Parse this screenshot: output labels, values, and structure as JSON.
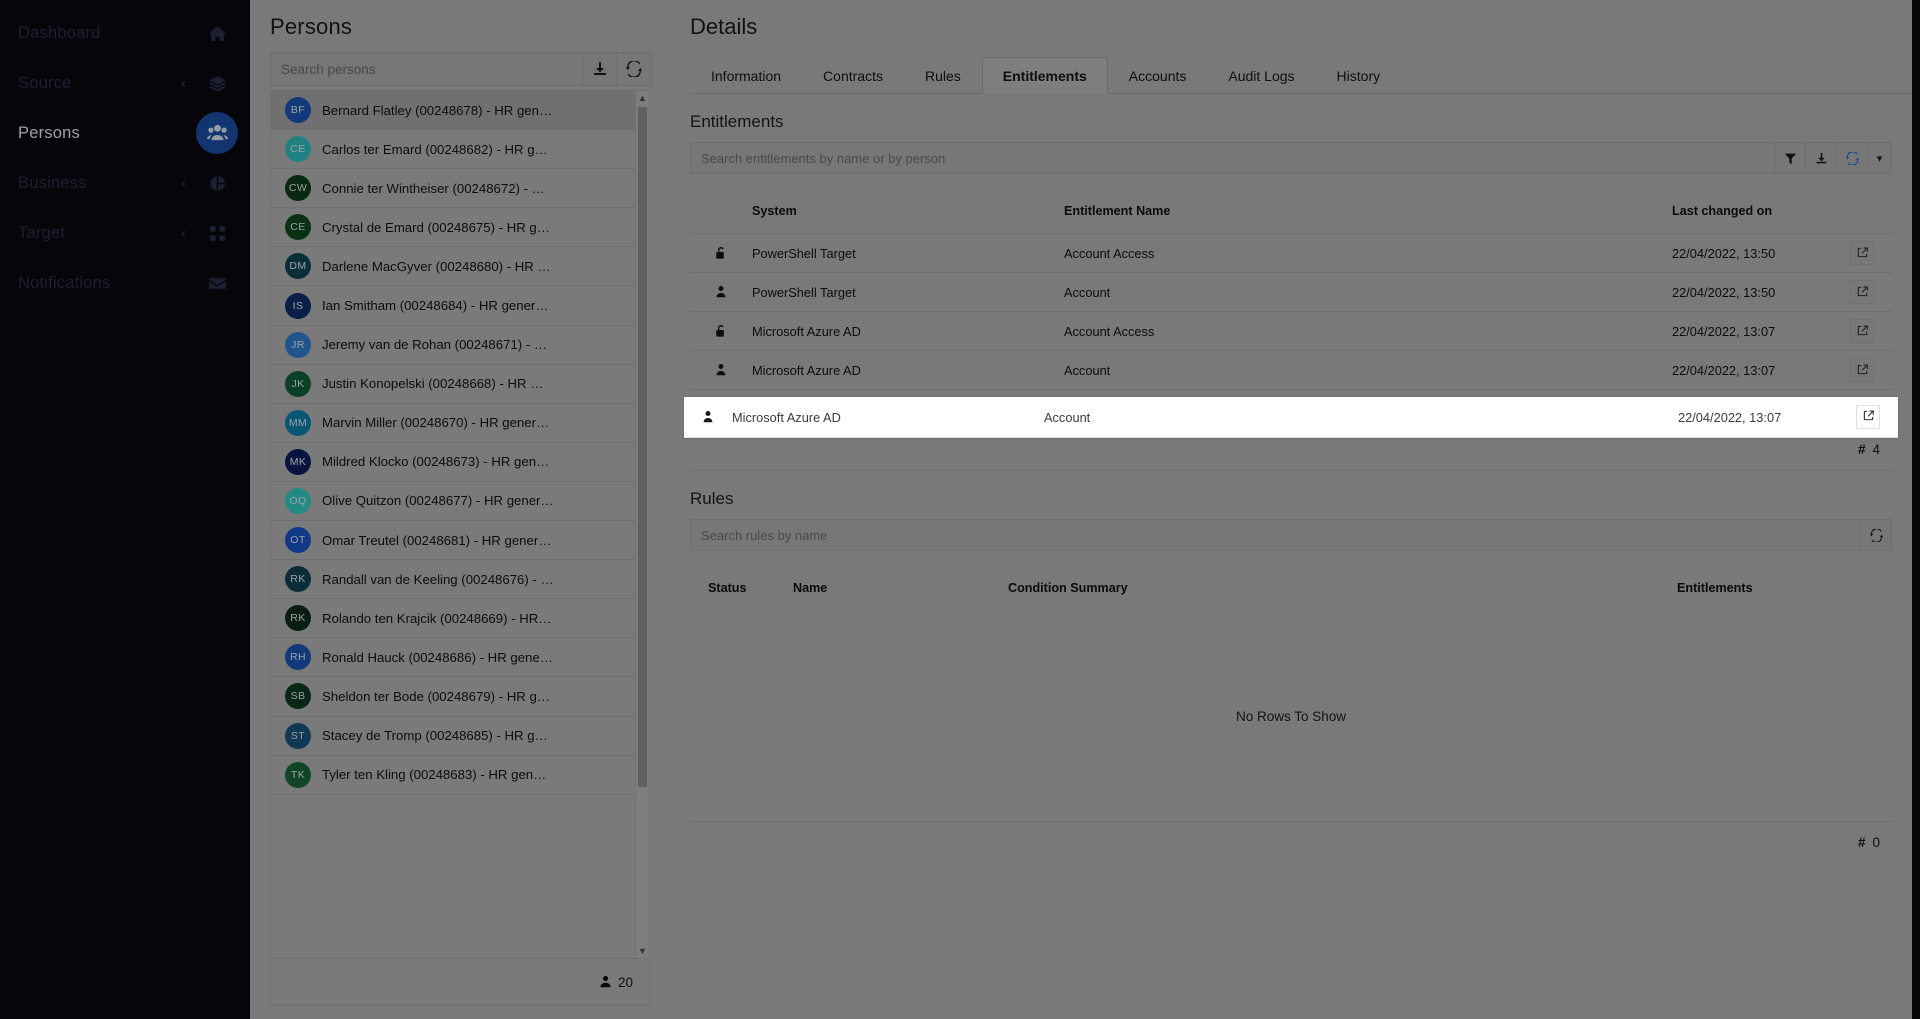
{
  "sidebar": {
    "items": [
      {
        "label": "Dashboard",
        "icon": "home-icon",
        "expandable": false,
        "active": false
      },
      {
        "label": "Source",
        "icon": "layers-icon",
        "expandable": true,
        "active": false
      },
      {
        "label": "Persons",
        "icon": "people-icon",
        "expandable": false,
        "active": true
      },
      {
        "label": "Business",
        "icon": "pie-chart-icon",
        "expandable": true,
        "active": false
      },
      {
        "label": "Target",
        "icon": "grid-icon",
        "expandable": true,
        "active": false
      },
      {
        "label": "Notifications",
        "icon": "envelope-icon",
        "expandable": false,
        "active": false
      }
    ],
    "chevron": "‹",
    "accent_color": "#1b4fa8"
  },
  "persons_panel": {
    "title": "Persons",
    "search_placeholder": "Search persons",
    "download_tooltip": "Download",
    "refresh_tooltip": "Refresh",
    "footer_count": "20",
    "items": [
      {
        "initials": "BF",
        "name": "Bernard Flatley (00248678) - HR gen…",
        "color": "#1b56b5",
        "selected": true
      },
      {
        "initials": "CE",
        "name": "Carlos ter Emard (00248682) - HR g…",
        "color": "#2fc1c0",
        "selected": false
      },
      {
        "initials": "CW",
        "name": "Connie ter Wintheiser (00248672) - …",
        "color": "#0c3d17",
        "selected": false
      },
      {
        "initials": "CE",
        "name": "Crystal de Emard (00248675) - HR g…",
        "color": "#0e4a1e",
        "selected": false
      },
      {
        "initials": "DM",
        "name": "Darlene MacGyver (00248680) - HR …",
        "color": "#0f4554",
        "selected": false
      },
      {
        "initials": "IS",
        "name": "Ian Smitham (00248684) - HR gener…",
        "color": "#0e2f6b",
        "selected": false
      },
      {
        "initials": "JR",
        "name": "Jeremy van de Rohan (00248671) - …",
        "color": "#2f7fd1",
        "selected": false
      },
      {
        "initials": "JK",
        "name": "Justin Konopelski (00248668) - HR …",
        "color": "#11603a",
        "selected": false
      },
      {
        "initials": "MM",
        "name": "Marvin Miller (00248670) - HR gener…",
        "color": "#0e7fae",
        "selected": false
      },
      {
        "initials": "MK",
        "name": "Mildred Klocko (00248673) - HR gen…",
        "color": "#0c1f5e",
        "selected": false
      },
      {
        "initials": "OQ",
        "name": "Olive Quitzon (00248677) - HR gener…",
        "color": "#33ccc4",
        "selected": false
      },
      {
        "initials": "OT",
        "name": "Omar Treutel (00248681) - HR gener…",
        "color": "#1b56c9",
        "selected": false
      },
      {
        "initials": "RK",
        "name": "Randall van de Keeling (00248676) - …",
        "color": "#0f4352",
        "selected": false
      },
      {
        "initials": "RK",
        "name": "Rolando ten Krajcik (00248669) - HR…",
        "color": "#0b2e18",
        "selected": false
      },
      {
        "initials": "RH",
        "name": "Ronald Hauck (00248686) - HR gene…",
        "color": "#1b56b5",
        "selected": false
      },
      {
        "initials": "SB",
        "name": "Sheldon ter Bode (00248679) - HR g…",
        "color": "#0d3b22",
        "selected": false
      },
      {
        "initials": "ST",
        "name": "Stacey de Tromp (00248685) - HR g…",
        "color": "#17567f",
        "selected": false
      },
      {
        "initials": "TK",
        "name": "Tyler ten Kling (00248683) - HR gen…",
        "color": "#18683a",
        "selected": false
      }
    ]
  },
  "details_panel": {
    "title": "Details",
    "tabs": [
      {
        "label": "Information",
        "active": false
      },
      {
        "label": "Contracts",
        "active": false
      },
      {
        "label": "Rules",
        "active": false
      },
      {
        "label": "Entitlements",
        "active": true
      },
      {
        "label": "Accounts",
        "active": false
      },
      {
        "label": "Audit Logs",
        "active": false
      },
      {
        "label": "History",
        "active": false
      }
    ]
  },
  "entitlements": {
    "title": "Entitlements",
    "search_placeholder": "Search entitlements by name or by person",
    "toolbar": {
      "filter": "filter-icon",
      "download": "download-icon",
      "refresh": "refresh-icon",
      "expand": "chevron-down-icon",
      "refresh_color": "#1565d8"
    },
    "columns": [
      "",
      "System",
      "Entitlement Name",
      "Last changed on",
      ""
    ],
    "rows": [
      {
        "icon": "unlock-icon",
        "system": "PowerShell Target",
        "name": "Account Access",
        "changed": "22/04/2022, 13:50",
        "action": "open-external-icon",
        "highlighted": false
      },
      {
        "icon": "person-icon",
        "system": "PowerShell Target",
        "name": "Account",
        "changed": "22/04/2022, 13:50",
        "action": "open-external-icon",
        "highlighted": false
      },
      {
        "icon": "unlock-icon",
        "system": "Microsoft Azure AD",
        "name": "Account Access",
        "changed": "22/04/2022, 13:07",
        "action": "open-external-icon",
        "highlighted": false
      },
      {
        "icon": "person-icon",
        "system": "Microsoft Azure AD",
        "name": "Account",
        "changed": "22/04/2022, 13:07",
        "action": "open-external-icon",
        "highlighted": true
      }
    ],
    "count_symbol": "#",
    "count": "4"
  },
  "rules": {
    "title": "Rules",
    "search_placeholder": "Search rules by name",
    "refresh_icon": "refresh-icon",
    "columns": [
      "Status",
      "Name",
      "Condition Summary",
      "Entitlements"
    ],
    "empty_text": "No Rows To Show",
    "count_symbol": "#",
    "count": "0"
  }
}
